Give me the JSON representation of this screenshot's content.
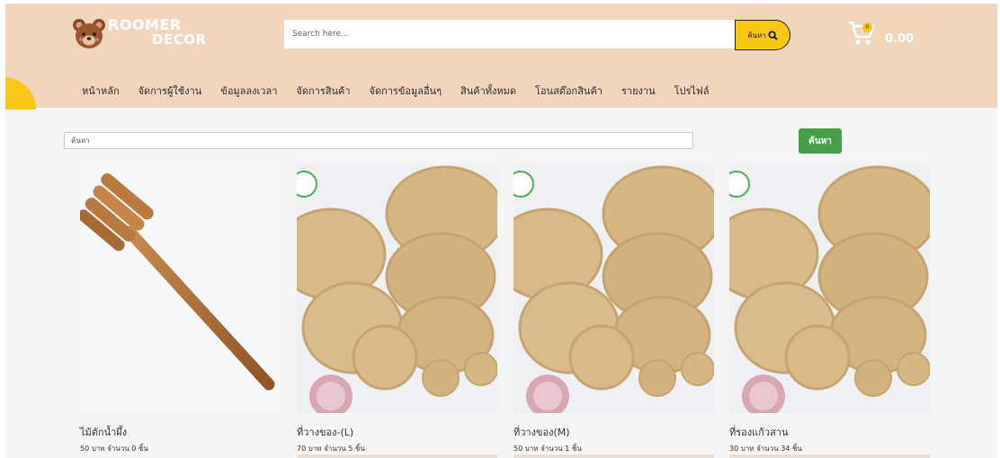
{
  "brand": {
    "line1": "ROOMER",
    "line2": "DECOR",
    "logo_icon": "bear-icon"
  },
  "search": {
    "placeholder": "Search here...",
    "button_label": "ค้นหา",
    "button_icon": "search-icon"
  },
  "cart": {
    "icon": "cart-icon",
    "badge": "0",
    "title": "Shopping Cart",
    "total": "0.00"
  },
  "nav": {
    "items": [
      {
        "label": "หน้าหลัก"
      },
      {
        "label": "จัดการผู้ใช้งาน"
      },
      {
        "label": "ข้อมูลลงเวลา"
      },
      {
        "label": "จัดการสินค้า"
      },
      {
        "label": "จัดการข้อมูลอื่นๆ"
      },
      {
        "label": "สินค้าทั้งหมด"
      },
      {
        "label": "โอนสต๊อกสินค้า"
      },
      {
        "label": "รายงาน"
      },
      {
        "label": "โปรไฟล์"
      }
    ]
  },
  "filter": {
    "placeholder": "ค้นหา",
    "button_label": "ค้นหา"
  },
  "colors": {
    "header_bg": "#f2d5bd",
    "accent_yellow": "#f7c617",
    "button_green": "#43a047"
  },
  "products": [
    {
      "name": "ไม้ตักน้ำผึ้ง",
      "info": "50 บาท จำนวน 0   ชิ้น",
      "image": "honey-dipper"
    },
    {
      "name": "ที่วางของ-(L)",
      "info": "70 บาท จำนวน 5   ชิ้น",
      "image": "woven-placemats"
    },
    {
      "name": "ที่วางของ(M)",
      "info": "50 บาท จำนวน 1   ชิ้น",
      "image": "woven-placemats"
    },
    {
      "name": "ที่รองแก้วสาน",
      "info": "30 บาท จำนวน 34   ชิ้น",
      "image": "woven-placemats"
    }
  ]
}
